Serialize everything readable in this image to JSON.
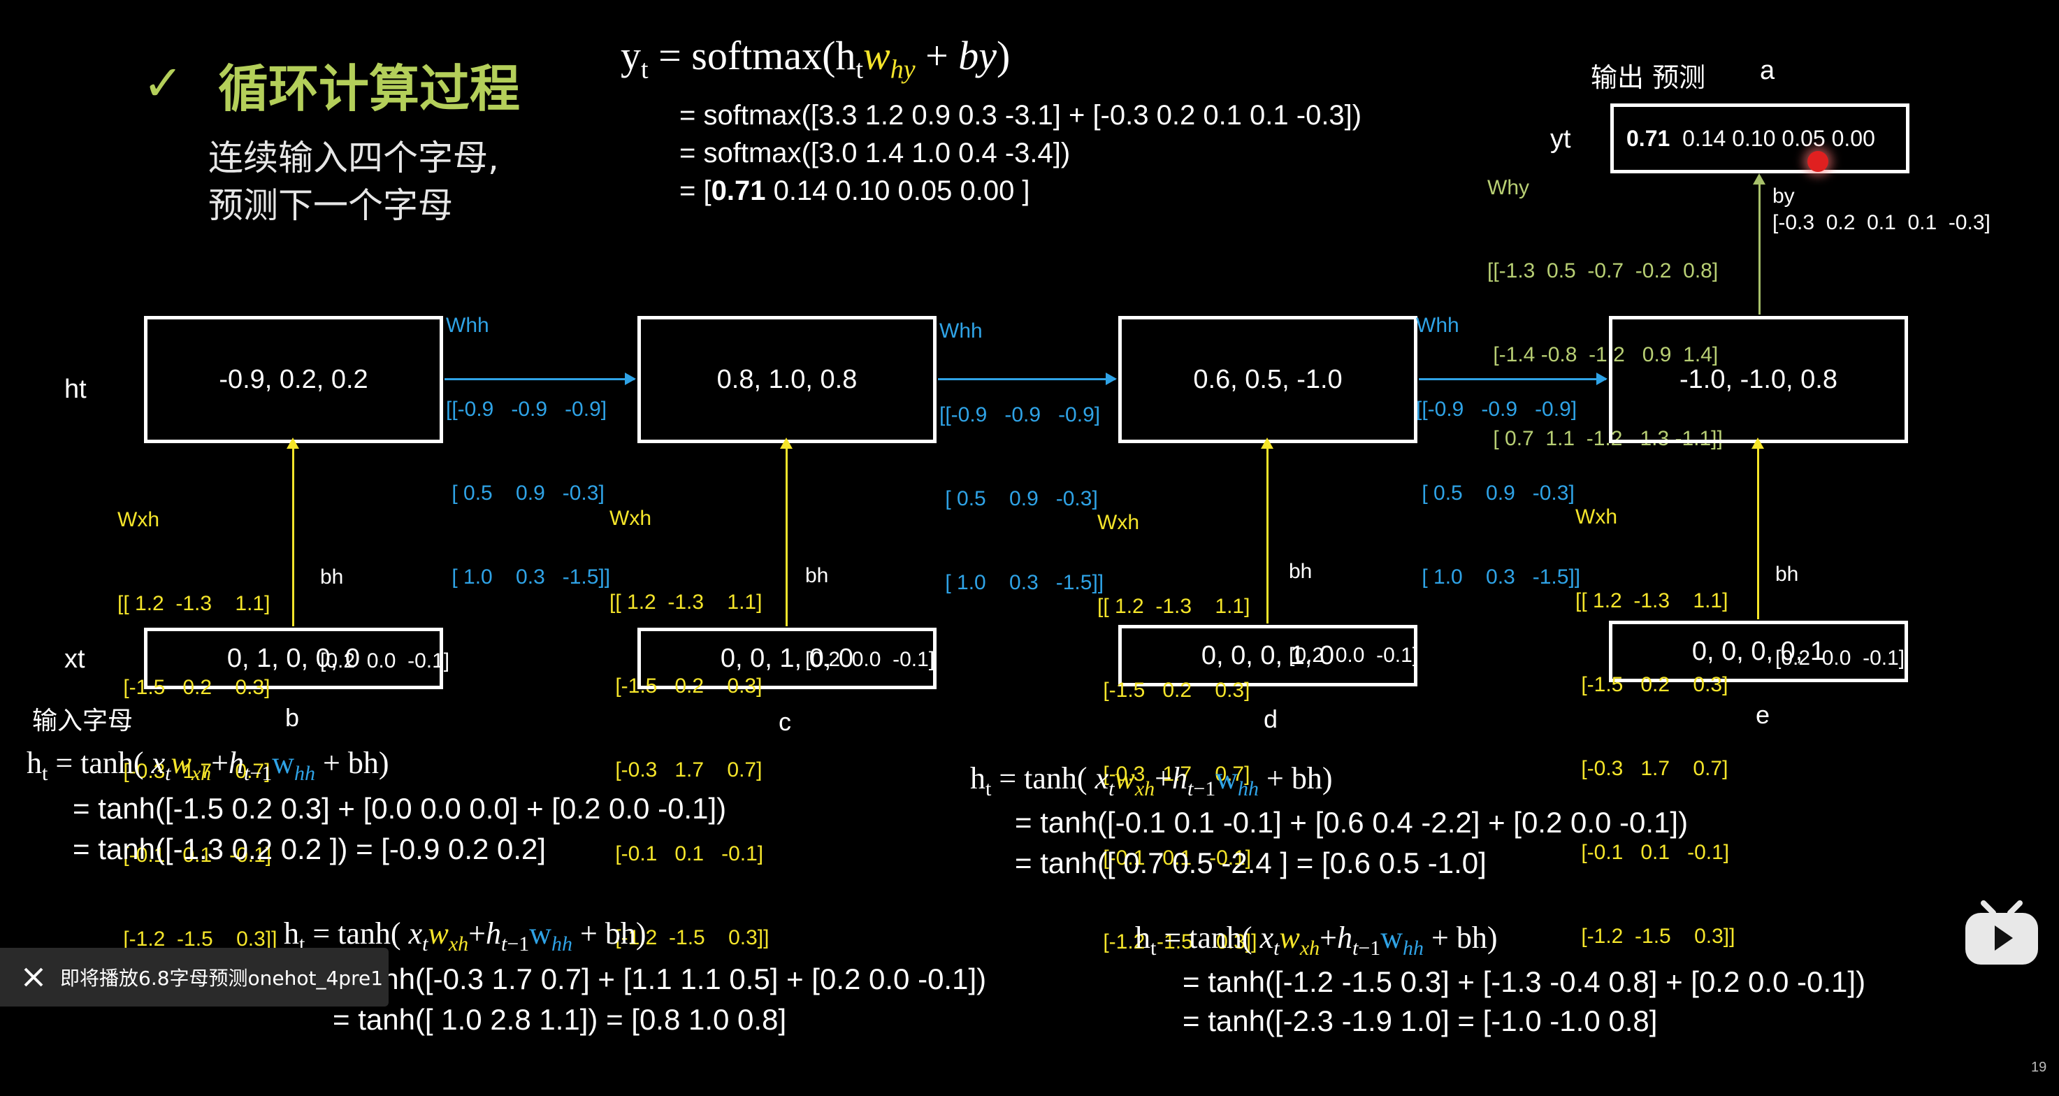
{
  "title": {
    "check": "✓",
    "text": "循环计算过程"
  },
  "subtitle": {
    "line1": "连续输入四个字母,",
    "line2": "预测下一个字母"
  },
  "top_eq": {
    "yt_lhs": "yt = softmax(htwhy + by)",
    "l1": "= softmax([3.3  1.2  0.9  0.3  -3.1] + [-0.3  0.2  0.1  0.1  -0.3])",
    "l2": "= softmax([3.0  1.4  1.0  0.4  -3.4])",
    "l3a": "= [",
    "l3b": "0.71",
    "l3c": "  0.14  0.10  0.05  0.00 ]"
  },
  "output": {
    "label": "输出 预测",
    "pred_letter": "a",
    "yt_label": "yt",
    "yt_first": "0.71",
    "yt_rest": "0.14  0.10  0.05  0.00"
  },
  "why": {
    "label": "Why",
    "rows": [
      "[[-1.3  0.5  -0.7  -0.2  0.8]",
      " [-1.4 -0.8  -1.2   0.9  1.4]",
      " [ 0.7  1.1  -1.2   1.3 -1.1]]"
    ]
  },
  "by": {
    "label": "by",
    "value": "[-0.3  0.2  0.1  0.1  -0.3]"
  },
  "whh": {
    "label": "Whh",
    "rows": [
      "[[-0.9   -0.9   -0.9]",
      " [ 0.5    0.9   -0.3]",
      " [ 1.0    0.3   -1.5]]"
    ]
  },
  "wxh": {
    "label": "Wxh",
    "rows": [
      "[[ 1.2  -1.3    1.1]",
      " [-1.5   0.2    0.3]",
      " [-0.3   1.7    0.7]",
      " [-0.1   0.1   -0.1]",
      " [-1.2  -1.5    0.3]]"
    ]
  },
  "bh": {
    "label": "bh",
    "value": "[0.2  0.0  -0.1]"
  },
  "row_labels": {
    "ht": "ht",
    "xt": "xt",
    "input": "输入字母"
  },
  "hidden_states": [
    "-0.9,   0.2,   0.2",
    "0.8,  1.0,  0.8",
    "0.6,  0.5,  -1.0",
    "-1.0,  -1.0,  0.8"
  ],
  "inputs": [
    "0,  1,  0,  0,  0",
    "0,  0,  1,  0,  0",
    "0,  0,  0,  1,  0",
    "0,  0,  0,  0,  1"
  ],
  "letters": [
    "b",
    "c",
    "d",
    "e"
  ],
  "eq_b": {
    "l2": "= tanh([-1.5  0.2  0.3] + [0.0  0.0  0.0] + [0.2  0.0  -0.1])",
    "l3": "= tanh([-1.3  0.2  0.2 ]) = [-0.9  0.2  0.2]"
  },
  "eq_d": {
    "l2": "= tanh([-0.1  0.1  -0.1] + [0.6  0.4  -2.2] + [0.2  0.0  -0.1])",
    "l3": "= tanh([ 0.7  0.5  -2.4 ] = [0.6  0.5  -1.0]"
  },
  "eq_c": {
    "l2": "= tanh([-0.3 1.7 0.7] + [1.1 1.1 0.5] + [0.2  0.0  -0.1])",
    "l3": "= tanh([ 1.0 2.8 1.1]) = [0.8  1.0  0.8]"
  },
  "eq_e": {
    "l2": "= tanh([-1.2  -1.5   0.3] + [-1.3  -0.4  0.8] + [0.2  0.0  -0.1])",
    "l3": "= tanh([-2.3  -1.9   1.0] = [-1.0  -1.0  0.8]"
  },
  "toast": {
    "text": "即将播放6.8字母预测onehot_4pre1"
  },
  "page_number": "19",
  "colors": {
    "green": "#b4cf5a",
    "yellow": "#f5e52a",
    "blue": "#2fa3e6",
    "red_dot": "#e02020"
  }
}
